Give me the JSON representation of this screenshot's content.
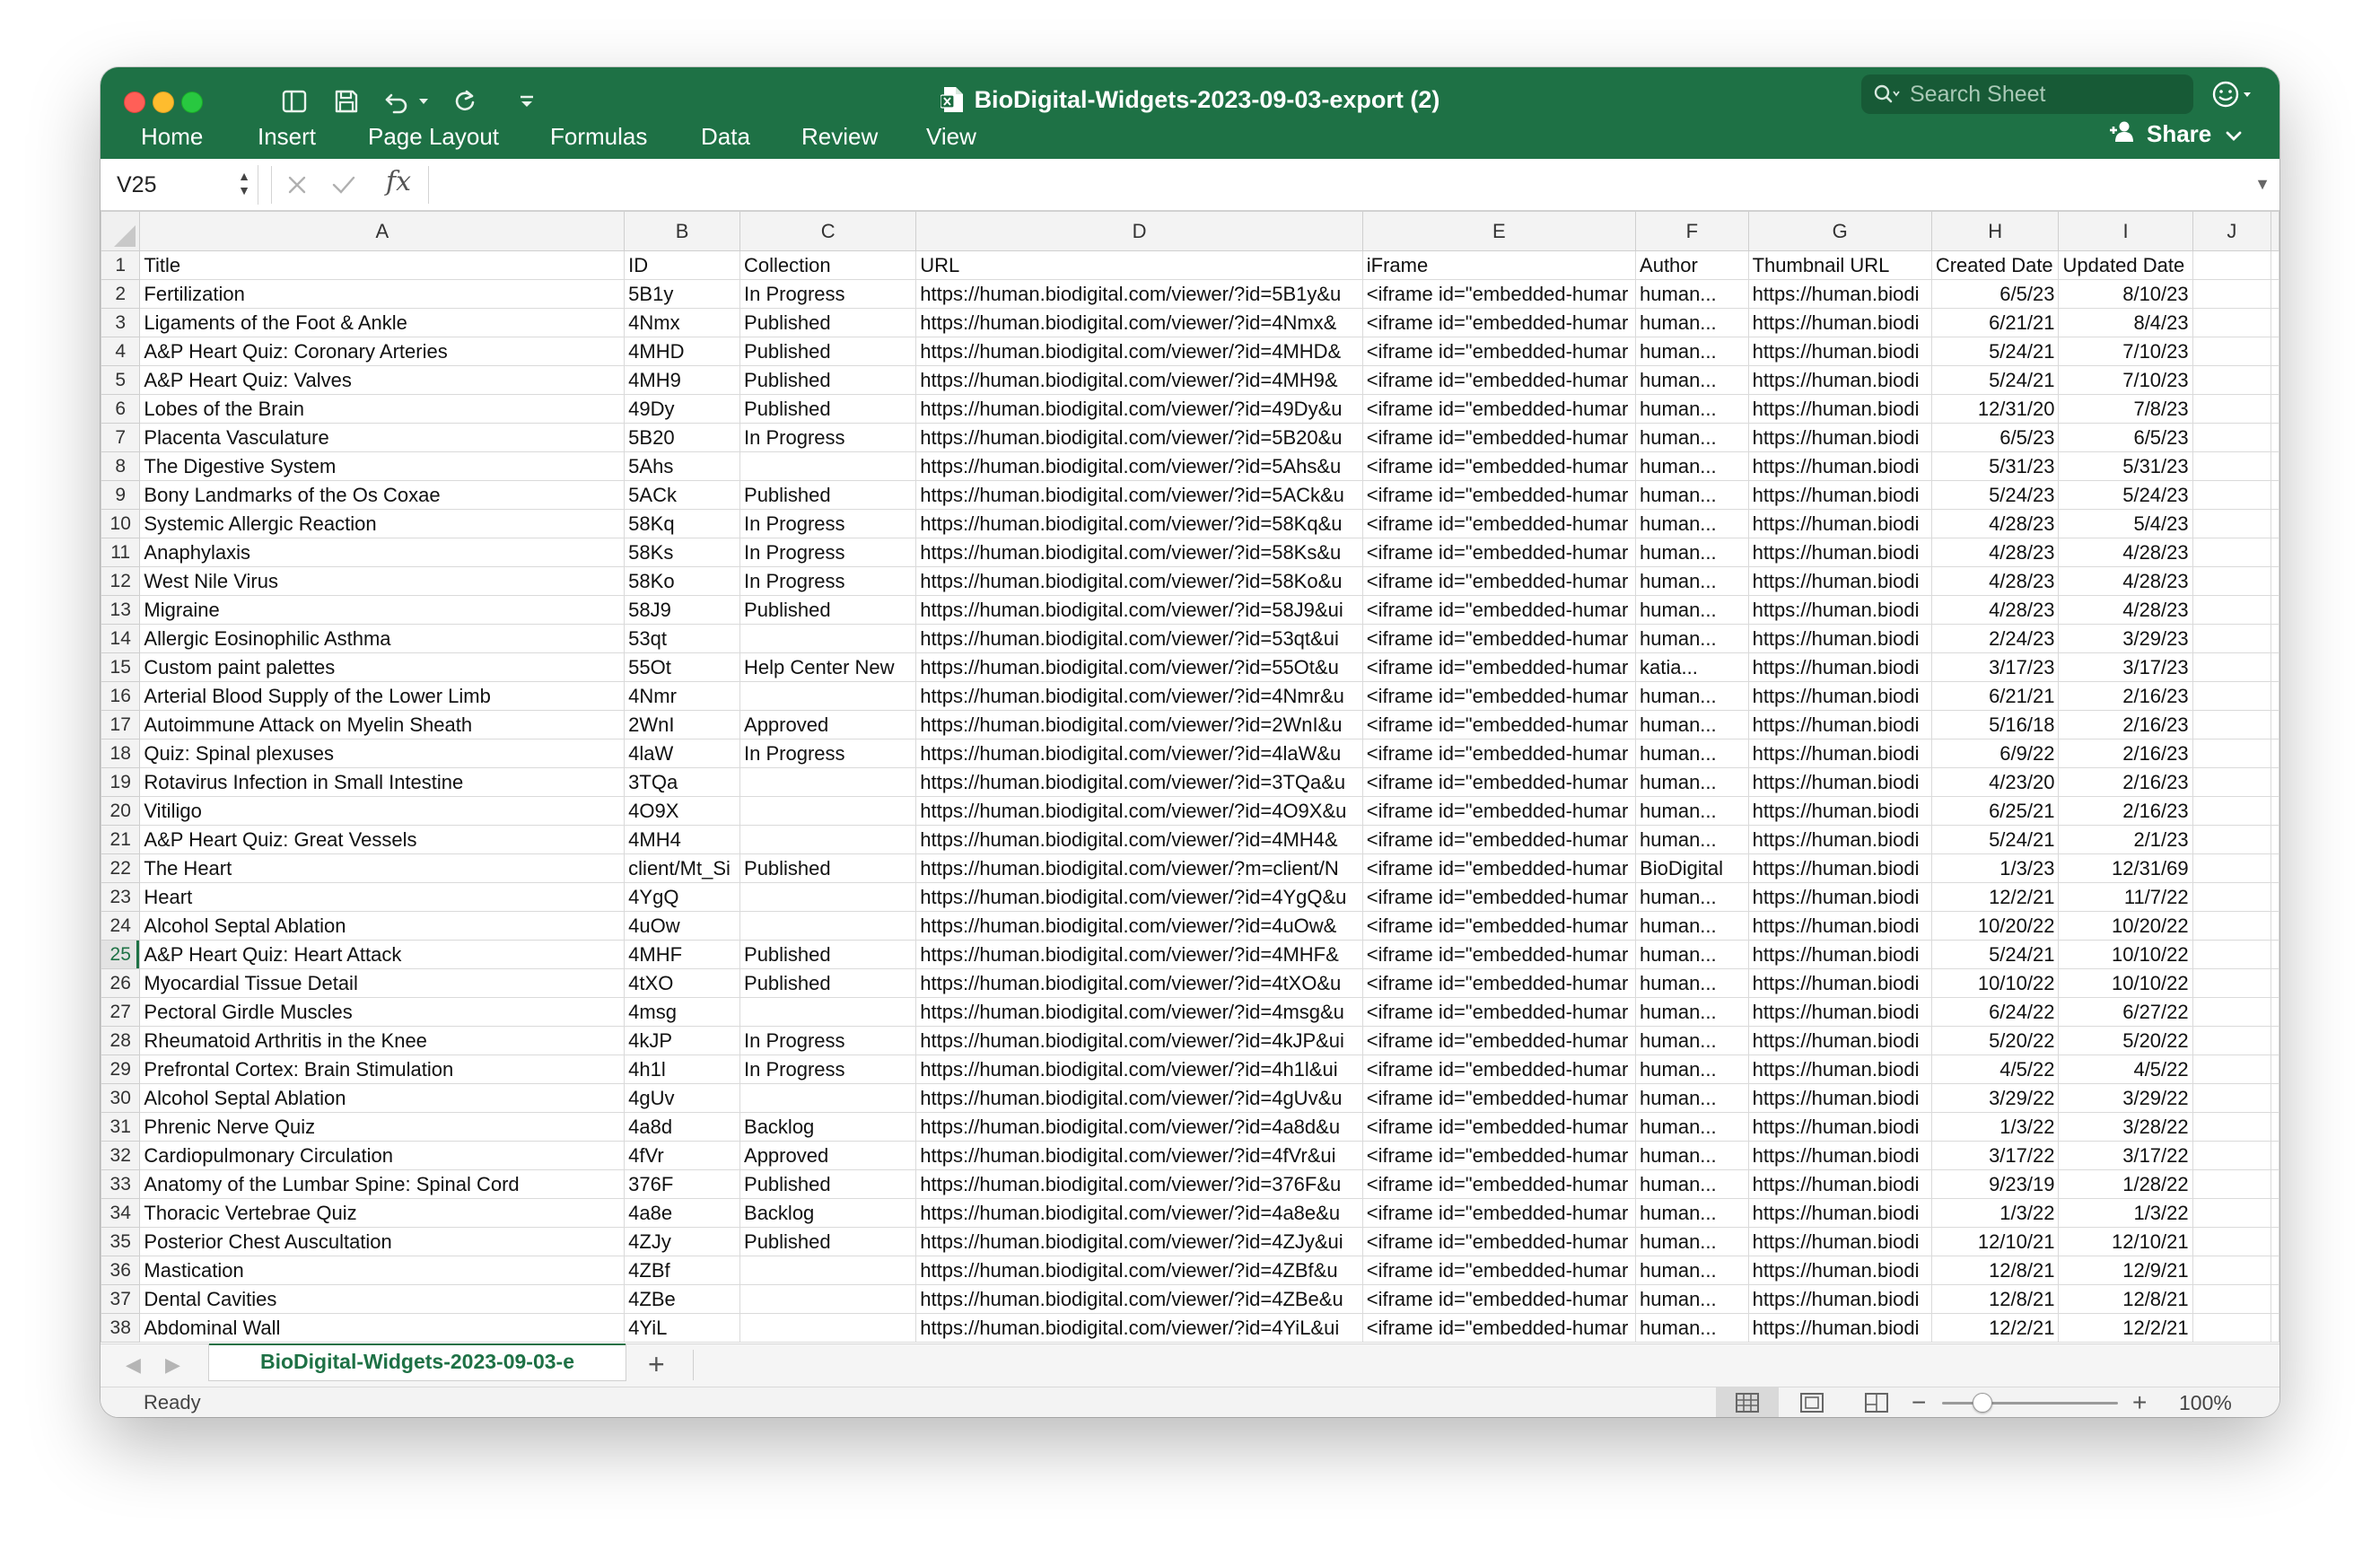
{
  "window": {
    "title": "BioDigital-Widgets-2023-09-03-export (2)",
    "search_placeholder": "Search Sheet",
    "share_label": "Share"
  },
  "ribbon": {
    "tabs": [
      "Home",
      "Insert",
      "Page Layout",
      "Formulas",
      "Data",
      "Review",
      "View"
    ]
  },
  "formula_bar": {
    "cell_ref": "V25",
    "fx_label": "fx",
    "content": ""
  },
  "sheet": {
    "column_letters": [
      "A",
      "B",
      "C",
      "D",
      "E",
      "F",
      "G",
      "H",
      "I",
      "J"
    ],
    "active_row": 25,
    "rows": [
      {
        "n": "1",
        "cells": [
          "Title",
          "ID",
          "Collection",
          "URL",
          "iFrame",
          "Author",
          "Thumbnail URL",
          "Created Date",
          "Updated Date"
        ]
      },
      {
        "n": "2",
        "cells": [
          "Fertilization",
          "5B1y",
          "In Progress",
          "https://human.biodigital.com/viewer/?id=5B1y&u",
          "<iframe id=\"embedded-humar",
          "human...",
          "https://human.biodi",
          "6/5/23",
          "8/10/23"
        ]
      },
      {
        "n": "3",
        "cells": [
          "Ligaments of the Foot & Ankle",
          "4Nmx",
          "Published",
          "https://human.biodigital.com/viewer/?id=4Nmx&",
          "<iframe id=\"embedded-humar",
          "human...",
          "https://human.biodi",
          "6/21/21",
          "8/4/23"
        ]
      },
      {
        "n": "4",
        "cells": [
          "A&P Heart Quiz: Coronary Arteries",
          "4MHD",
          "Published",
          "https://human.biodigital.com/viewer/?id=4MHD&",
          "<iframe id=\"embedded-humar",
          "human...",
          "https://human.biodi",
          "5/24/21",
          "7/10/23"
        ]
      },
      {
        "n": "5",
        "cells": [
          "A&P Heart Quiz: Valves",
          "4MH9",
          "Published",
          "https://human.biodigital.com/viewer/?id=4MH9&",
          "<iframe id=\"embedded-humar",
          "human...",
          "https://human.biodi",
          "5/24/21",
          "7/10/23"
        ]
      },
      {
        "n": "6",
        "cells": [
          "Lobes of the Brain",
          "49Dy",
          "Published",
          "https://human.biodigital.com/viewer/?id=49Dy&u",
          "<iframe id=\"embedded-humar",
          "human...",
          "https://human.biodi",
          "12/31/20",
          "7/8/23"
        ]
      },
      {
        "n": "7",
        "cells": [
          "Placenta Vasculature",
          "5B20",
          "In Progress",
          "https://human.biodigital.com/viewer/?id=5B20&u",
          "<iframe id=\"embedded-humar",
          "human...",
          "https://human.biodi",
          "6/5/23",
          "6/5/23"
        ]
      },
      {
        "n": "8",
        "cells": [
          "The Digestive System",
          "5Ahs",
          "",
          "https://human.biodigital.com/viewer/?id=5Ahs&u",
          "<iframe id=\"embedded-humar",
          "human...",
          "https://human.biodi",
          "5/31/23",
          "5/31/23"
        ]
      },
      {
        "n": "9",
        "cells": [
          "Bony Landmarks of the Os Coxae",
          "5ACk",
          "Published",
          "https://human.biodigital.com/viewer/?id=5ACk&u",
          "<iframe id=\"embedded-humar",
          "human...",
          "https://human.biodi",
          "5/24/23",
          "5/24/23"
        ]
      },
      {
        "n": "10",
        "cells": [
          "Systemic Allergic Reaction",
          "58Kq",
          "In Progress",
          "https://human.biodigital.com/viewer/?id=58Kq&u",
          "<iframe id=\"embedded-humar",
          "human...",
          "https://human.biodi",
          "4/28/23",
          "5/4/23"
        ]
      },
      {
        "n": "11",
        "cells": [
          "Anaphylaxis",
          "58Ks",
          "In Progress",
          "https://human.biodigital.com/viewer/?id=58Ks&u",
          "<iframe id=\"embedded-humar",
          "human...",
          "https://human.biodi",
          "4/28/23",
          "4/28/23"
        ]
      },
      {
        "n": "12",
        "cells": [
          "West Nile Virus",
          "58Ko",
          "In Progress",
          "https://human.biodigital.com/viewer/?id=58Ko&u",
          "<iframe id=\"embedded-humar",
          "human...",
          "https://human.biodi",
          "4/28/23",
          "4/28/23"
        ]
      },
      {
        "n": "13",
        "cells": [
          "Migraine",
          "58J9",
          "Published",
          "https://human.biodigital.com/viewer/?id=58J9&ui",
          "<iframe id=\"embedded-humar",
          "human...",
          "https://human.biodi",
          "4/28/23",
          "4/28/23"
        ]
      },
      {
        "n": "14",
        "cells": [
          "Allergic Eosinophilic Asthma",
          "53qt",
          "",
          "https://human.biodigital.com/viewer/?id=53qt&ui",
          "<iframe id=\"embedded-humar",
          "human...",
          "https://human.biodi",
          "2/24/23",
          "3/29/23"
        ]
      },
      {
        "n": "15",
        "cells": [
          "Custom paint palettes",
          "55Ot",
          "Help Center New",
          "https://human.biodigital.com/viewer/?id=55Ot&u",
          "<iframe id=\"embedded-humar",
          "katia...",
          "https://human.biodi",
          "3/17/23",
          "3/17/23"
        ]
      },
      {
        "n": "16",
        "cells": [
          "Arterial Blood Supply of the Lower Limb",
          "4Nmr",
          "",
          "https://human.biodigital.com/viewer/?id=4Nmr&u",
          "<iframe id=\"embedded-humar",
          "human...",
          "https://human.biodi",
          "6/21/21",
          "2/16/23"
        ]
      },
      {
        "n": "17",
        "cells": [
          "Autoimmune Attack on Myelin Sheath",
          "2WnI",
          "Approved",
          "https://human.biodigital.com/viewer/?id=2WnI&u",
          "<iframe id=\"embedded-humar",
          "human...",
          "https://human.biodi",
          "5/16/18",
          "2/16/23"
        ]
      },
      {
        "n": "18",
        "cells": [
          "Quiz: Spinal plexuses",
          "4laW",
          "In Progress",
          "https://human.biodigital.com/viewer/?id=4laW&u",
          "<iframe id=\"embedded-humar",
          "human...",
          "https://human.biodi",
          "6/9/22",
          "2/16/23"
        ]
      },
      {
        "n": "19",
        "cells": [
          "Rotavirus Infection in Small Intestine",
          "3TQa",
          "",
          "https://human.biodigital.com/viewer/?id=3TQa&u",
          "<iframe id=\"embedded-humar",
          "human...",
          "https://human.biodi",
          "4/23/20",
          "2/16/23"
        ]
      },
      {
        "n": "20",
        "cells": [
          "Vitiligo",
          "4O9X",
          "",
          "https://human.biodigital.com/viewer/?id=4O9X&u",
          "<iframe id=\"embedded-humar",
          "human...",
          "https://human.biodi",
          "6/25/21",
          "2/16/23"
        ]
      },
      {
        "n": "21",
        "cells": [
          "A&P Heart Quiz: Great Vessels",
          "4MH4",
          "",
          "https://human.biodigital.com/viewer/?id=4MH4&",
          "<iframe id=\"embedded-humar",
          "human...",
          "https://human.biodi",
          "5/24/21",
          "2/1/23"
        ]
      },
      {
        "n": "22",
        "cells": [
          "The Heart",
          "client/Mt_Si",
          "Published",
          "https://human.biodigital.com/viewer/?m=client/N",
          "<iframe id=\"embedded-humar",
          "BioDigital",
          "https://human.biodi",
          "1/3/23",
          "12/31/69"
        ]
      },
      {
        "n": "23",
        "cells": [
          "Heart",
          "4YgQ",
          "",
          "https://human.biodigital.com/viewer/?id=4YgQ&u",
          "<iframe id=\"embedded-humar",
          "human...",
          "https://human.biodi",
          "12/2/21",
          "11/7/22"
        ]
      },
      {
        "n": "24",
        "cells": [
          "Alcohol Septal Ablation",
          "4uOw",
          "",
          "https://human.biodigital.com/viewer/?id=4uOw&",
          "<iframe id=\"embedded-humar",
          "human...",
          "https://human.biodi",
          "10/20/22",
          "10/20/22"
        ]
      },
      {
        "n": "25",
        "cells": [
          "A&P Heart Quiz: Heart Attack",
          "4MHF",
          "Published",
          "https://human.biodigital.com/viewer/?id=4MHF&",
          "<iframe id=\"embedded-humar",
          "human...",
          "https://human.biodi",
          "5/24/21",
          "10/10/22"
        ]
      },
      {
        "n": "26",
        "cells": [
          "Myocardial Tissue Detail",
          "4tXO",
          "Published",
          "https://human.biodigital.com/viewer/?id=4tXO&u",
          "<iframe id=\"embedded-humar",
          "human...",
          "https://human.biodi",
          "10/10/22",
          "10/10/22"
        ]
      },
      {
        "n": "27",
        "cells": [
          "Pectoral Girdle Muscles",
          "4msg",
          "",
          "https://human.biodigital.com/viewer/?id=4msg&u",
          "<iframe id=\"embedded-humar",
          "human...",
          "https://human.biodi",
          "6/24/22",
          "6/27/22"
        ]
      },
      {
        "n": "28",
        "cells": [
          "Rheumatoid Arthritis in the Knee",
          "4kJP",
          "In Progress",
          "https://human.biodigital.com/viewer/?id=4kJP&ui",
          "<iframe id=\"embedded-humar",
          "human...",
          "https://human.biodi",
          "5/20/22",
          "5/20/22"
        ]
      },
      {
        "n": "29",
        "cells": [
          "Prefrontal Cortex: Brain Stimulation",
          "4h1l",
          "In Progress",
          "https://human.biodigital.com/viewer/?id=4h1l&ui",
          "<iframe id=\"embedded-humar",
          "human...",
          "https://human.biodi",
          "4/5/22",
          "4/5/22"
        ]
      },
      {
        "n": "30",
        "cells": [
          "Alcohol Septal Ablation",
          "4gUv",
          "",
          "https://human.biodigital.com/viewer/?id=4gUv&u",
          "<iframe id=\"embedded-humar",
          "human...",
          "https://human.biodi",
          "3/29/22",
          "3/29/22"
        ]
      },
      {
        "n": "31",
        "cells": [
          "Phrenic Nerve Quiz",
          "4a8d",
          "Backlog",
          "https://human.biodigital.com/viewer/?id=4a8d&u",
          "<iframe id=\"embedded-humar",
          "human...",
          "https://human.biodi",
          "1/3/22",
          "3/28/22"
        ]
      },
      {
        "n": "32",
        "cells": [
          "Cardiopulmonary Circulation",
          "4fVr",
          "Approved",
          "https://human.biodigital.com/viewer/?id=4fVr&ui",
          "<iframe id=\"embedded-humar",
          "human...",
          "https://human.biodi",
          "3/17/22",
          "3/17/22"
        ]
      },
      {
        "n": "33",
        "cells": [
          "Anatomy of the Lumbar Spine: Spinal Cord",
          "376F",
          "Published",
          "https://human.biodigital.com/viewer/?id=376F&u",
          "<iframe id=\"embedded-humar",
          "human...",
          "https://human.biodi",
          "9/23/19",
          "1/28/22"
        ]
      },
      {
        "n": "34",
        "cells": [
          "Thoracic Vertebrae Quiz",
          "4a8e",
          "Backlog",
          "https://human.biodigital.com/viewer/?id=4a8e&u",
          "<iframe id=\"embedded-humar",
          "human...",
          "https://human.biodi",
          "1/3/22",
          "1/3/22"
        ]
      },
      {
        "n": "35",
        "cells": [
          "Posterior Chest Auscultation",
          "4ZJy",
          "Published",
          "https://human.biodigital.com/viewer/?id=4ZJy&ui",
          "<iframe id=\"embedded-humar",
          "human...",
          "https://human.biodi",
          "12/10/21",
          "12/10/21"
        ]
      },
      {
        "n": "36",
        "cells": [
          "Mastication",
          "4ZBf",
          "",
          "https://human.biodigital.com/viewer/?id=4ZBf&u",
          "<iframe id=\"embedded-humar",
          "human...",
          "https://human.biodi",
          "12/8/21",
          "12/9/21"
        ]
      },
      {
        "n": "37",
        "cells": [
          "Dental Cavities",
          "4ZBe",
          "",
          "https://human.biodigital.com/viewer/?id=4ZBe&u",
          "<iframe id=\"embedded-humar",
          "human...",
          "https://human.biodi",
          "12/8/21",
          "12/8/21"
        ]
      },
      {
        "n": "38",
        "cells": [
          "Abdominal Wall",
          "4YiL",
          "",
          "https://human.biodigital.com/viewer/?id=4YiL&ui",
          "<iframe id=\"embedded-humar",
          "human...",
          "https://human.biodi",
          "12/2/21",
          "12/2/21"
        ]
      }
    ]
  },
  "sheet_tabs": {
    "active_tab": "BioDigital-Widgets-2023-09-03-e",
    "add_label": "+"
  },
  "status_bar": {
    "status": "Ready",
    "zoom": "100%"
  },
  "colors": {
    "excel_green": "#1e7145",
    "close": "#ff5f57",
    "minimize": "#febc2e",
    "maximize": "#28c840"
  }
}
